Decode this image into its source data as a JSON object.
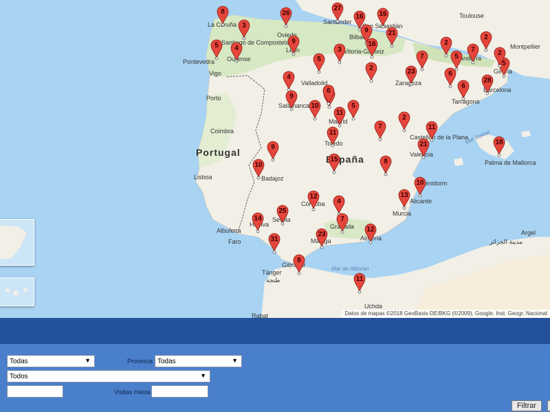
{
  "map": {
    "attribution": "Datos de mapas ©2018 GeoBasis-DE/BKG (©2009), Google, Inst. Geogr. Nacional",
    "countries": [
      "Portugal",
      "España"
    ],
    "seas": [
      "Mar de Alborán",
      "Mar Balear"
    ],
    "cities": [
      "La Coruña",
      "Santiago de Compostela",
      "Pontevedra",
      "Vigo",
      "Ourense",
      "Oviedo",
      "León",
      "Santander",
      "Bilbao",
      "San Sebastián",
      "Vitoria-Gasteiz",
      "Toulouse",
      "Montpellier",
      "Andorra",
      "Girona",
      "Barcelona",
      "Tarragona",
      "Zaragoza",
      "Valladolid",
      "Salamanca",
      "Madrid",
      "Toledo",
      "Porto",
      "Coimbra",
      "Lisboa",
      "Badajoz",
      "Valencia",
      "Castellón de la Plana",
      "Palma de Mallorca",
      "Benidorm",
      "Alicante",
      "Murcia",
      "Córdoba",
      "Sevilla",
      "Huelva",
      "Granada",
      "Almería",
      "Málaga",
      "Albufeira",
      "Faro",
      "Gibraltar",
      "Tánger",
      "طنجة",
      "Argel",
      "مدينة الجزائر",
      "Rabat",
      "Uchda"
    ],
    "markers": [
      "8",
      "3",
      "5",
      "4",
      "26",
      "9",
      "27",
      "16",
      "16",
      "9",
      "16",
      "21",
      "5",
      "3",
      "2",
      "5",
      "7",
      "6",
      "23",
      "2",
      "4",
      "7",
      "2",
      "5",
      "6",
      "28",
      "9",
      "6",
      "10",
      "11",
      "5",
      "2",
      "11",
      "7",
      "11",
      "18",
      "21",
      "9",
      "15",
      "8",
      "10",
      "12",
      "4",
      "13",
      "10",
      "25",
      "14",
      "7",
      "12",
      "31",
      "23",
      "8",
      "11",
      "6",
      "2"
    ]
  },
  "filters": {
    "select_1_value": "Todas",
    "provincia_label": "Provincia",
    "provincia_value": "Todas",
    "select_2_value": "Todos",
    "visitas_desde_value": "",
    "visitas_hasta_label": "Visitas Hasta",
    "visitas_hasta_value": "",
    "filter_button": "Filtrar"
  },
  "colors": {
    "sea": "#a9d3f3",
    "land": "#f2efe6",
    "marker": "#e5463c",
    "band": "#23519b",
    "panel": "#4a7fcc"
  }
}
